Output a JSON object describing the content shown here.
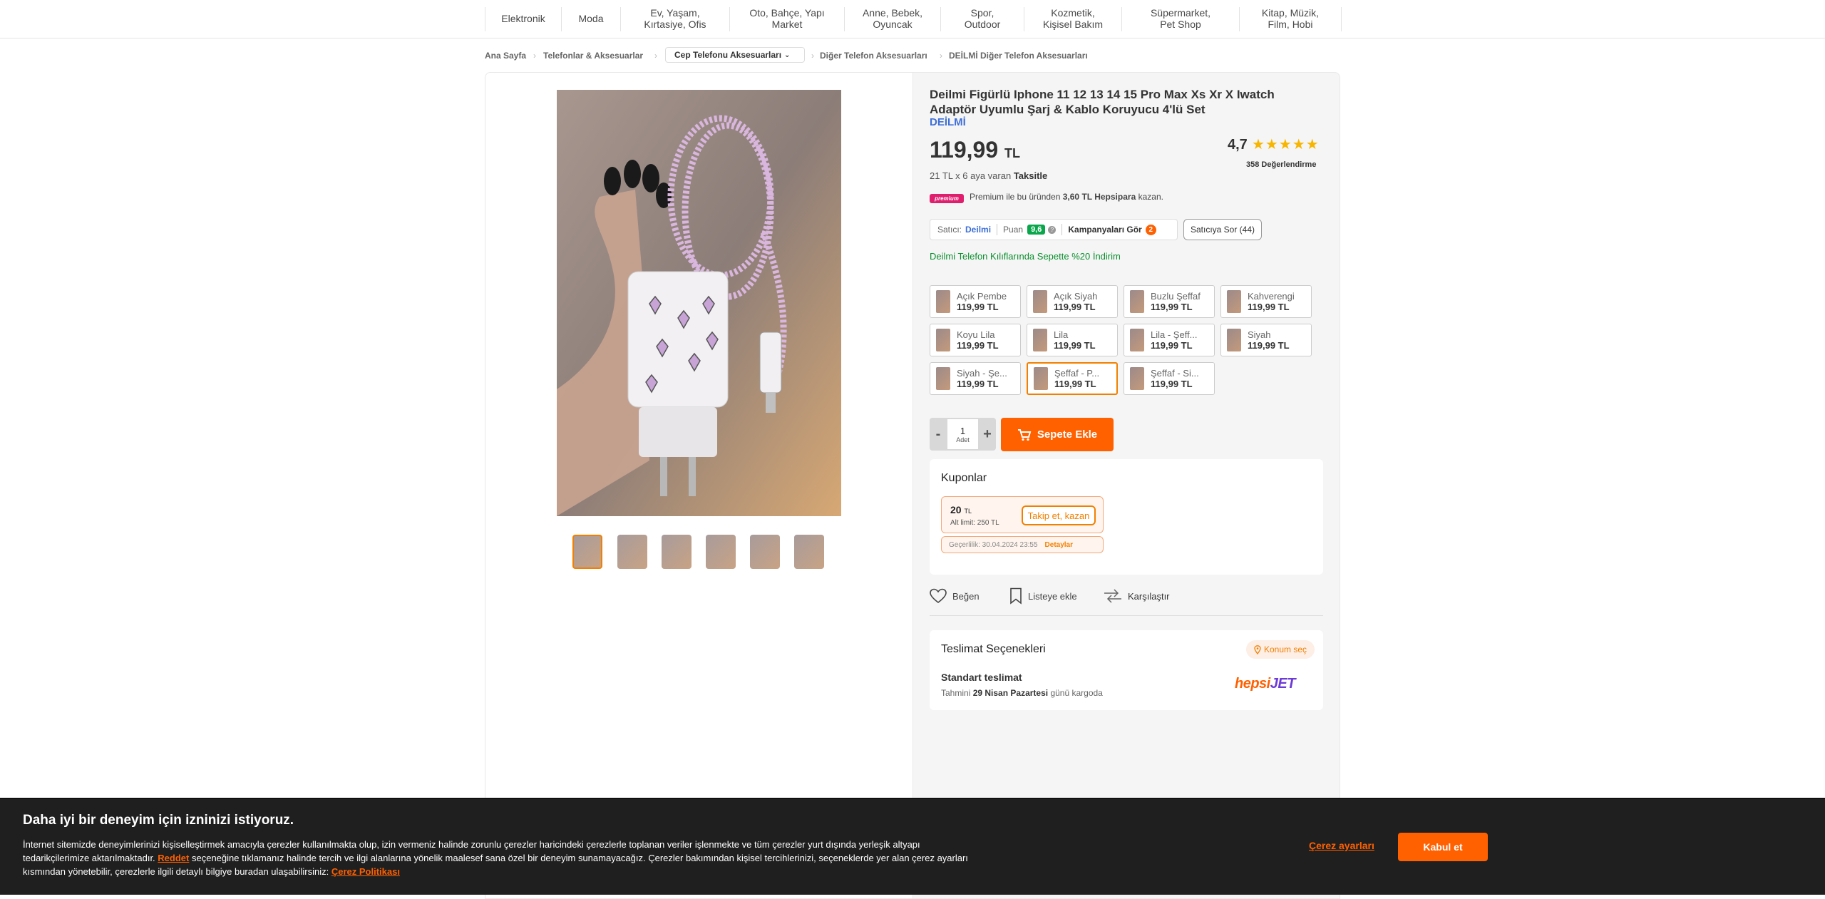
{
  "nav": {
    "categories": [
      "Elektronik",
      "Moda",
      "Ev, Yaşam,\nKırtasiye, Ofis",
      "Oto, Bahçe, Yapı\nMarket",
      "Anne, Bebek,\nOyuncak",
      "Spor,\nOutdoor",
      "Kozmetik,\nKişisel Bakım",
      "Süpermarket,\nPet Shop",
      "Kitap, Müzik,\nFilm, Hobi"
    ]
  },
  "breadcrumb": {
    "home": "Ana Sayfa",
    "level1": "Telefonlar & Aksesuarlar",
    "level2": "Cep Telefonu Aksesuarları",
    "level3": "Diğer Telefon Aksesuarları",
    "level4": "DEİLMİ Diğer Telefon Aksesuarları"
  },
  "product": {
    "title": "Deilmi Figürlü Iphone 11 12 13 14 15 Pro Max Xs Xr X Iwatch Adaptör Uyumlu Şarj & Kablo Koruyucu 4'lü Set",
    "brand": "DEİLMİ",
    "price": "119,99",
    "currency": "TL",
    "installment_prefix": "21 TL x 6 aya varan",
    "installment_label": "Taksitle",
    "rating": "4,7",
    "stars": "★★★★★",
    "reviews": "358 Değerlendirme",
    "thumbnail_count": 6,
    "selected_thumbnail": 1
  },
  "premium": {
    "badge": "premium",
    "text_prefix": "Premium ile bu üründen",
    "amount": "3,60 TL Hepsipara",
    "text_suffix": "kazan."
  },
  "seller": {
    "label": "Satıcı:",
    "name": "Deilmi",
    "score_label": "Puan",
    "score": "9,6",
    "campaigns_label": "Kampanyaları Gör",
    "campaigns_count": "2",
    "ask_button": "Satıcıya Sor (44)"
  },
  "campaign_text": "Deilmi Telefon Kılıflarında Sepette %20 İndirim",
  "variants": [
    {
      "name": "Açık Pembe",
      "price": "119,99 TL"
    },
    {
      "name": "Açık Siyah",
      "price": "119,99 TL"
    },
    {
      "name": "Buzlu Şeffaf",
      "price": "119,99 TL"
    },
    {
      "name": "Kahverengi",
      "price": "119,99 TL"
    },
    {
      "name": "Koyu Lila",
      "price": "119,99 TL"
    },
    {
      "name": "Lila",
      "price": "119,99 TL"
    },
    {
      "name": "Lila - Şeff...",
      "price": "119,99 TL"
    },
    {
      "name": "Siyah",
      "price": "119,99 TL"
    },
    {
      "name": "Siyah - Şe...",
      "price": "119,99 TL"
    },
    {
      "name": "Şeffaf - P...",
      "price": "119,99 TL",
      "selected": true
    },
    {
      "name": "Şeffaf - Si...",
      "price": "119,99 TL"
    }
  ],
  "cart": {
    "minus": "-",
    "plus": "+",
    "quantity": "1",
    "unit": "Adet",
    "add_to_cart": "Sepete Ekle"
  },
  "coupons": {
    "heading": "Kuponlar",
    "amount": "20",
    "currency": "TL",
    "limit": "Alt limit: 250 TL",
    "follow_button": "Takip et, kazan",
    "validity": "Geçerlilik: 30.04.2024 23:55",
    "details": "Detaylar"
  },
  "actions": {
    "like": "Beğen",
    "add_list": "Listeye ekle",
    "compare": "Karşılaştır"
  },
  "delivery": {
    "heading": "Teslimat Seçenekleri",
    "location_button": "Konum seç",
    "standard": "Standart teslimat",
    "estimate_prefix": "Tahmini",
    "estimate_date": "29 Nisan Pazartesi",
    "estimate_suffix": "günü kargoda",
    "carrier_a": "hepsi",
    "carrier_b": "JET"
  },
  "cookie": {
    "heading": "Daha iyi bir deneyim için izninizi istiyoruz.",
    "body_1": "İnternet sitemizde deneyimlerinizi kişiselleştirmek amacıyla çerezler kullanılmakta olup, izin vermeniz halinde zorunlu çerezler haricindeki çerezlerle toplanan veriler işlenmekte ve tüm çerezler yurt dışında yerleşik altyapı tedarikçilerimize aktarılmaktadır.",
    "reject_link": "Reddet",
    "body_2": "seçeneğine tıklamanız halinde tercih ve ilgi alanlarına yönelik maalesef sana özel bir deneyim sunamayacağız. Çerezler bakımından kişisel tercihlerinizi, seçeneklerde yer alan çerez ayarları kısmından yönetebilir, çerezlerle ilgili detaylı bilgiye buradan ulaşabilirsiniz:",
    "policy_link": "Çerez Politikası",
    "settings_link": "Çerez ayarları",
    "accept_button": "Kabul et"
  },
  "colors": {
    "accent": "#ff6000",
    "brand_blue": "#3e6fd8",
    "campaign_green": "#0a8f2e",
    "star": "#f7b500"
  }
}
